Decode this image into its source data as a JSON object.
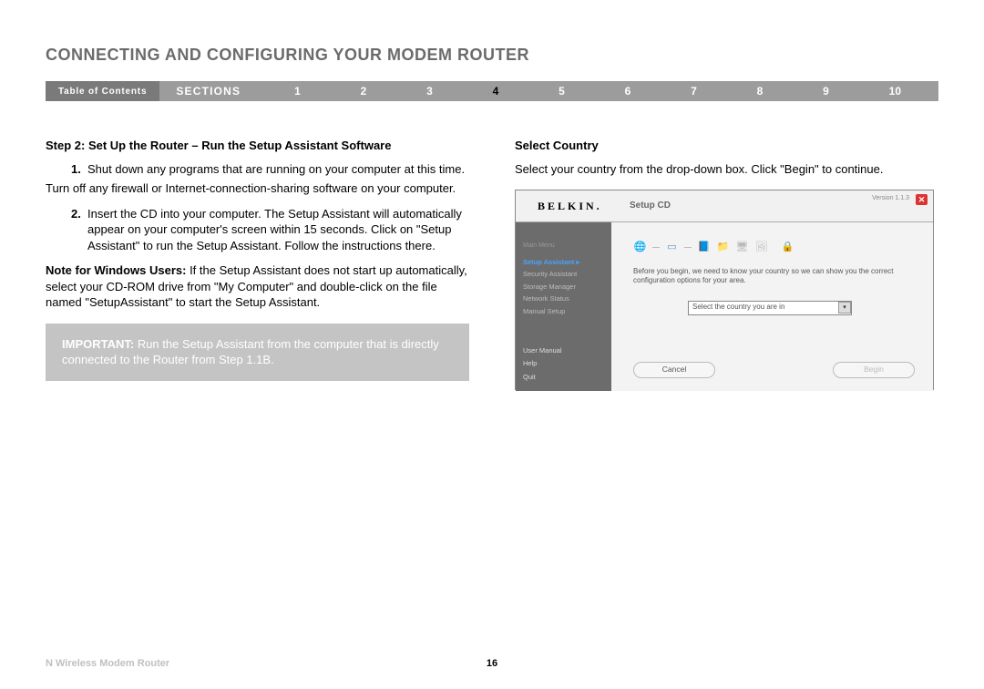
{
  "header": {
    "title": "CONNECTING AND CONFIGURING YOUR MODEM ROUTER"
  },
  "nav": {
    "toc": "Table of Contents",
    "sections_label": "SECTIONS",
    "items": [
      "1",
      "2",
      "3",
      "4",
      "5",
      "6",
      "7",
      "8",
      "9",
      "10"
    ],
    "active": "4"
  },
  "left": {
    "heading": "Step 2: Set Up the Router – Run the Setup Assistant Software",
    "item1_num": "1.",
    "item1_text": "Shut down any programs that are running on your computer at this time.",
    "firewall": "Turn off any firewall or Internet-connection-sharing software on your computer.",
    "item2_num": "2.",
    "item2_text": "Insert the CD into your computer. The Setup Assistant will automatically appear on your computer's screen within 15 seconds. Click on \"Setup Assistant\" to run the Setup Assistant. Follow the instructions there.",
    "note_label": "Note for Windows Users:",
    "note_text": " If the Setup Assistant does not start up automatically, select your CD-ROM drive from \"My Computer\" and double-click on the file named \"SetupAssistant\" to start the Setup Assistant.",
    "important_label": "IMPORTANT:",
    "important_text": " Run the Setup Assistant from the computer that is directly connected to the Router from Step 1.1B."
  },
  "right": {
    "heading": "Select Country",
    "body": "Select your country from the drop-down box. Click \"Begin\" to continue."
  },
  "shot": {
    "logo": "BELKIN.",
    "title": "Setup CD",
    "version": "Version 1.1.3",
    "mainmenu": "Main Menu",
    "side_items": {
      "setup": "Setup Assistant  ▸",
      "security": "Security Assistant",
      "storage": "Storage Manager",
      "network": "Network Status",
      "manual": "Manual Setup"
    },
    "side_items2": {
      "usermanual": "User Manual",
      "help": "Help",
      "quit": "Quit"
    },
    "message": "Before you begin, we need to know your country so we can show you the correct configuration options for your area.",
    "select_placeholder": "Select the country you are in",
    "btn_cancel": "Cancel",
    "btn_begin": "Begin"
  },
  "footer": {
    "product": "N Wireless Modem Router",
    "page": "16"
  }
}
